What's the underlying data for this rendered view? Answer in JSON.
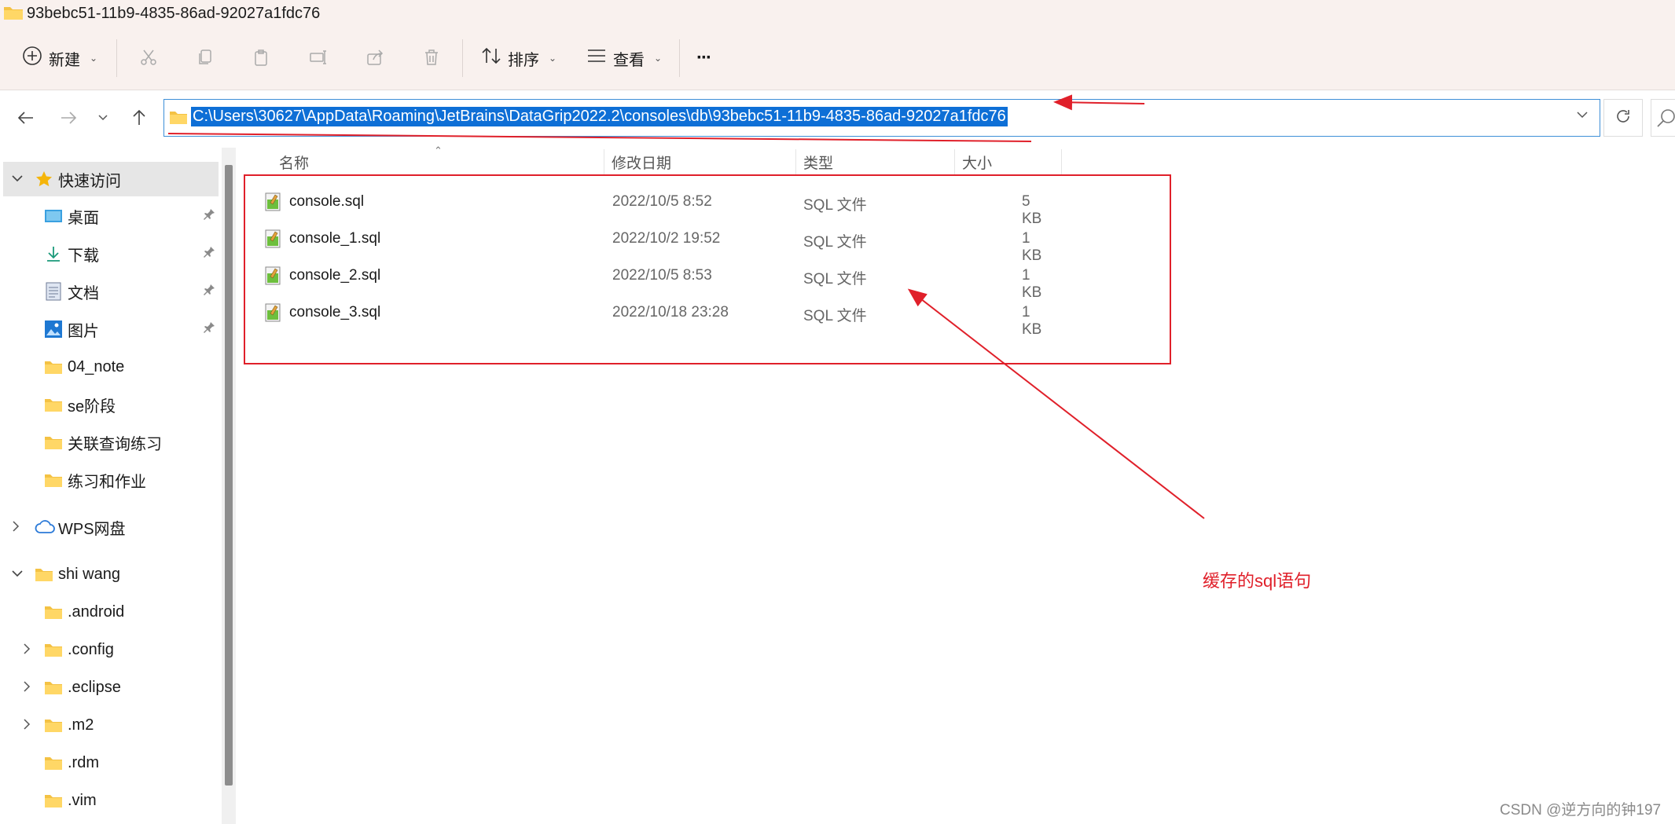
{
  "window": {
    "title": "93bebc51-11b9-4835-86ad-92027a1fdc76"
  },
  "toolbar": {
    "new_label": "新建",
    "sort_label": "排序",
    "view_label": "查看",
    "more_label": "···"
  },
  "address": {
    "path": "C:\\Users\\30627\\AppData\\Roaming\\JetBrains\\DataGrip2022.2\\consoles\\db\\93bebc51-11b9-4835-86ad-92027a1fdc76"
  },
  "sidebar": {
    "quick_access": "快速访问",
    "items": [
      {
        "label": "桌面",
        "icon": "desktop-icon",
        "pinned": true
      },
      {
        "label": "下载",
        "icon": "download-icon",
        "pinned": true
      },
      {
        "label": "文档",
        "icon": "document-icon",
        "pinned": true
      },
      {
        "label": "图片",
        "icon": "picture-icon",
        "pinned": true
      },
      {
        "label": "04_note",
        "icon": "folder-icon",
        "pinned": false
      },
      {
        "label": "se阶段",
        "icon": "folder-icon",
        "pinned": false
      },
      {
        "label": "关联查询练习",
        "icon": "folder-icon",
        "pinned": false
      },
      {
        "label": "练习和作业",
        "icon": "folder-icon",
        "pinned": false
      }
    ],
    "wps": "WPS网盘",
    "user": "shi wang",
    "user_items": [
      {
        "label": ".android",
        "expandable": false
      },
      {
        "label": ".config",
        "expandable": true
      },
      {
        "label": ".eclipse",
        "expandable": true
      },
      {
        "label": ".m2",
        "expandable": true
      },
      {
        "label": ".rdm",
        "expandable": false
      },
      {
        "label": ".vim",
        "expandable": false
      }
    ]
  },
  "columns": {
    "name": "名称",
    "modified": "修改日期",
    "type": "类型",
    "size": "大小"
  },
  "files": [
    {
      "name": "console.sql",
      "modified": "2022/10/5 8:52",
      "type": "SQL 文件",
      "size": "5 KB"
    },
    {
      "name": "console_1.sql",
      "modified": "2022/10/2 19:52",
      "type": "SQL 文件",
      "size": "1 KB"
    },
    {
      "name": "console_2.sql",
      "modified": "2022/10/5 8:53",
      "type": "SQL 文件",
      "size": "1 KB"
    },
    {
      "name": "console_3.sql",
      "modified": "2022/10/18 23:28",
      "type": "SQL 文件",
      "size": "1 KB"
    }
  ],
  "annotation": {
    "text": "缓存的sql语句",
    "color": "#e0202a"
  },
  "watermark": "CSDN @逆方向的钟197"
}
